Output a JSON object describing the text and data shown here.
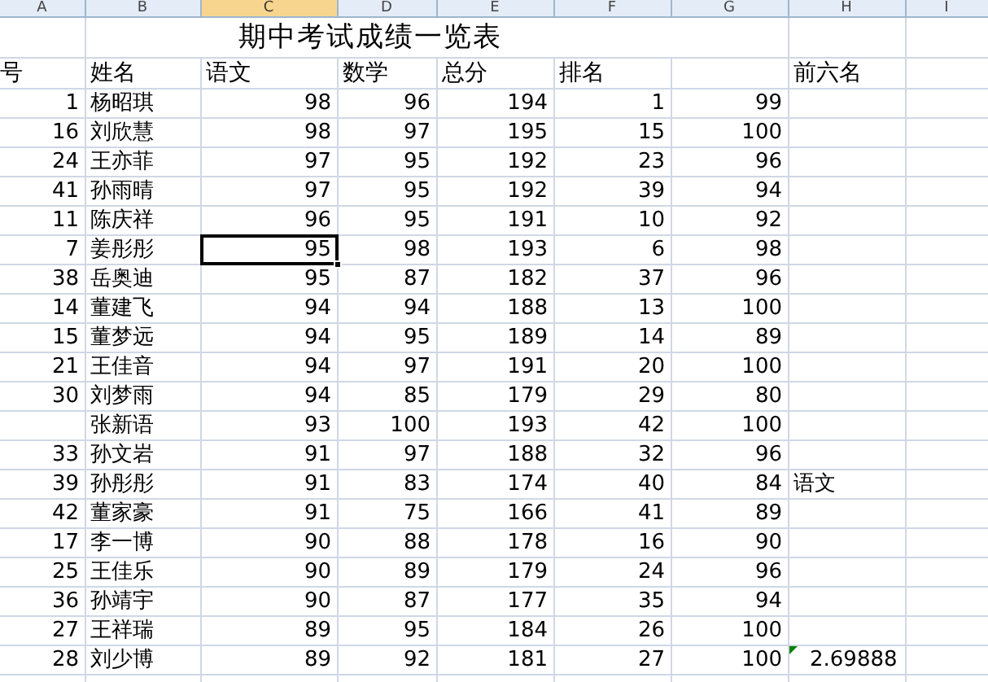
{
  "column_headers": [
    {
      "label": "A",
      "selected": false
    },
    {
      "label": "B",
      "selected": false
    },
    {
      "label": "C",
      "selected": true
    },
    {
      "label": "D",
      "selected": false
    },
    {
      "label": "E",
      "selected": false
    },
    {
      "label": "F",
      "selected": false
    },
    {
      "label": "G",
      "selected": false
    },
    {
      "label": "H",
      "selected": false
    },
    {
      "label": "I",
      "selected": false
    }
  ],
  "title": "期中考试成绩一览表",
  "header": {
    "a": "号",
    "b": "姓名",
    "c": "语文",
    "d": "数学",
    "e": "总分",
    "f": "排名",
    "h": "前六名"
  },
  "rows": [
    {
      "a": "1",
      "b": "杨昭琪",
      "c": "98",
      "d": "96",
      "e": "194",
      "f": "1",
      "g": "99",
      "active": false,
      "error_mark": false
    },
    {
      "a": "16",
      "b": "刘欣慧",
      "c": "98",
      "d": "97",
      "e": "195",
      "f": "15",
      "g": "100",
      "active": false,
      "error_mark": false
    },
    {
      "a": "24",
      "b": "王亦菲",
      "c": "97",
      "d": "95",
      "e": "192",
      "f": "23",
      "g": "96",
      "active": false,
      "error_mark": false
    },
    {
      "a": "41",
      "b": "孙雨晴",
      "c": "97",
      "d": "95",
      "e": "192",
      "f": "39",
      "g": "94",
      "active": false,
      "error_mark": false
    },
    {
      "a": "11",
      "b": "陈庆祥",
      "c": "96",
      "d": "95",
      "e": "191",
      "f": "10",
      "g": "92",
      "active": false,
      "error_mark": false
    },
    {
      "a": "7",
      "b": "姜彤彤",
      "c": "95",
      "d": "98",
      "e": "193",
      "f": "6",
      "g": "98",
      "active": true,
      "error_mark": false
    },
    {
      "a": "38",
      "b": "岳奥迪",
      "c": "95",
      "d": "87",
      "e": "182",
      "f": "37",
      "g": "96",
      "active": false,
      "error_mark": false
    },
    {
      "a": "14",
      "b": "董建飞",
      "c": "94",
      "d": "94",
      "e": "188",
      "f": "13",
      "g": "100",
      "active": false,
      "error_mark": false
    },
    {
      "a": "15",
      "b": "董梦远",
      "c": "94",
      "d": "95",
      "e": "189",
      "f": "14",
      "g": "89",
      "active": false,
      "error_mark": false
    },
    {
      "a": "21",
      "b": "王佳音",
      "c": "94",
      "d": "97",
      "e": "191",
      "f": "20",
      "g": "100",
      "active": false,
      "error_mark": false
    },
    {
      "a": "30",
      "b": "刘梦雨",
      "c": "94",
      "d": "85",
      "e": "179",
      "f": "29",
      "g": "80",
      "active": false,
      "error_mark": false
    },
    {
      "b": "张新语",
      "c": "93",
      "d": "100",
      "e": "193",
      "f": "42",
      "g": "100",
      "active": false,
      "error_mark": false
    },
    {
      "a": "33",
      "b": "孙文岩",
      "c": "91",
      "d": "97",
      "e": "188",
      "f": "32",
      "g": "96",
      "active": false,
      "error_mark": false
    },
    {
      "a": "39",
      "b": "孙彤彤",
      "c": "91",
      "d": "83",
      "e": "174",
      "f": "40",
      "g": "84",
      "h": "语文",
      "active": false,
      "error_mark": false
    },
    {
      "a": "42",
      "b": "董家豪",
      "c": "91",
      "d": "75",
      "e": "166",
      "f": "41",
      "g": "89",
      "active": false,
      "error_mark": false
    },
    {
      "a": "17",
      "b": "李一博",
      "c": "90",
      "d": "88",
      "e": "178",
      "f": "16",
      "g": "90",
      "active": false,
      "error_mark": false
    },
    {
      "a": "25",
      "b": "王佳乐",
      "c": "90",
      "d": "89",
      "e": "179",
      "f": "24",
      "g": "96",
      "active": false,
      "error_mark": false
    },
    {
      "a": "36",
      "b": "孙靖宇",
      "c": "90",
      "d": "87",
      "e": "177",
      "f": "35",
      "g": "94",
      "active": false,
      "error_mark": false
    },
    {
      "a": "27",
      "b": "王祥瑞",
      "c": "89",
      "d": "95",
      "e": "184",
      "f": "26",
      "g": "100",
      "active": false,
      "error_mark": false
    },
    {
      "a": "28",
      "b": "刘少博",
      "c": "89",
      "d": "92",
      "e": "181",
      "f": "27",
      "g": "100",
      "h": "2.69888",
      "active": false,
      "error_mark": true
    }
  ]
}
